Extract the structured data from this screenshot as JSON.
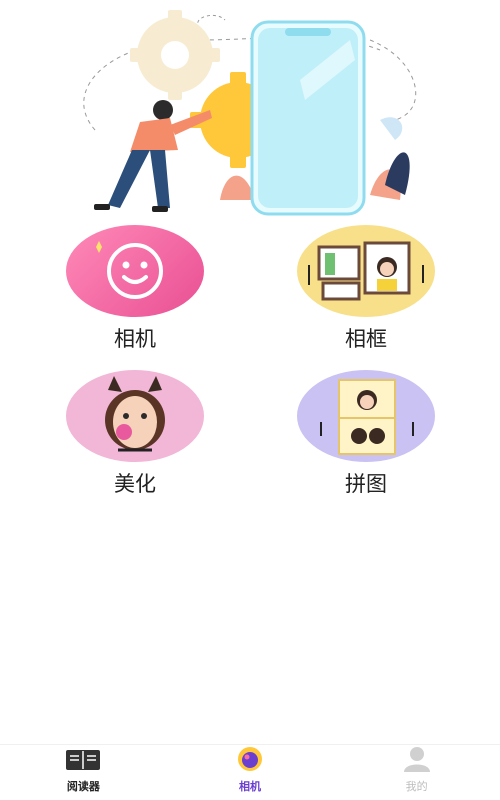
{
  "grid": {
    "items": [
      {
        "label": "相机",
        "icon": "smiley-icon"
      },
      {
        "label": "相框",
        "icon": "photo-frame-icon"
      },
      {
        "label": "美化",
        "icon": "beauty-portrait-icon"
      },
      {
        "label": "拼图",
        "icon": "collage-icon"
      }
    ]
  },
  "tabbar": {
    "tabs": [
      {
        "label": "阅读器",
        "icon": "book-icon",
        "state": "normal"
      },
      {
        "label": "相机",
        "icon": "camera-lens-icon",
        "state": "active"
      },
      {
        "label": "我的",
        "icon": "person-icon",
        "state": "inactive"
      }
    ]
  },
  "colors": {
    "accent": "#6a3fd0",
    "camera_tile": "#f06aa5",
    "frame_tile": "#f8e08a",
    "beauty_tile": "#f2b6d6",
    "collage_tile": "#c9c2f2",
    "phone_screen": "#bfeff8"
  }
}
